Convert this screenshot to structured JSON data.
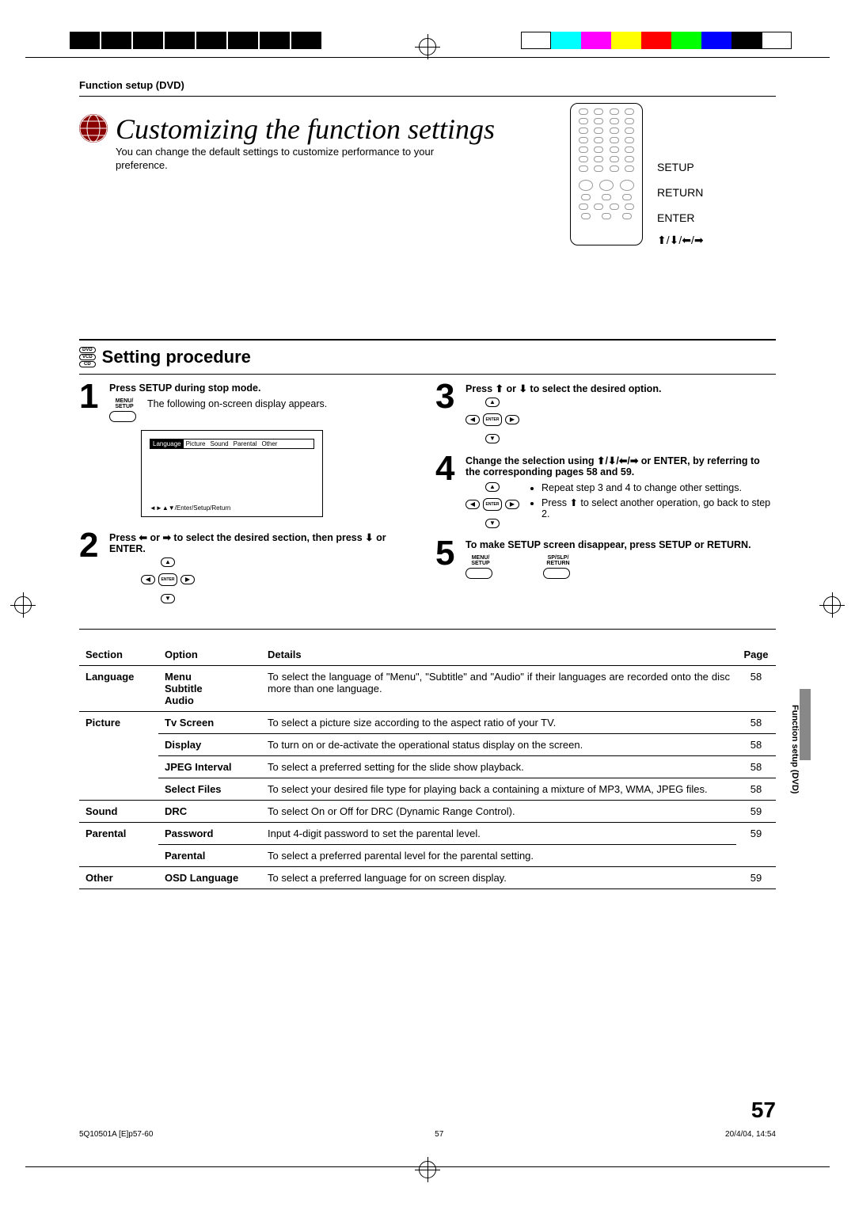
{
  "header": "Function setup (DVD)",
  "title": "Customizing the function settings",
  "intro": "You can change the default settings to customize performance to your preference.",
  "remote_labels": {
    "setup": "SETUP",
    "return": "RETURN",
    "enter": "ENTER"
  },
  "badges": [
    "DVD",
    "VCD",
    "CD"
  ],
  "section_title": "Setting procedure",
  "steps": {
    "s1": {
      "head": "Press SETUP during stop mode.",
      "key": "MENU/\nSETUP",
      "text": "The following on-screen display appears.",
      "osd_tabs": [
        "Language",
        "Picture",
        "Sound",
        "Parental",
        "Other"
      ],
      "osd_foot": "◄►▲▼/Enter/Setup/Return"
    },
    "s2": {
      "head_a": "Press ",
      "head_b": " or ",
      "head_c": " to select the desired section, then press ",
      "head_d": " or ENTER."
    },
    "s3": {
      "head_a": "Press ",
      "head_b": " or ",
      "head_c": " to select the desired option."
    },
    "s4": {
      "head_a": "Change the selection using ",
      "head_b": " or ENTER, by referring to the corresponding pages 58 and 59.",
      "b1": "Repeat step 3 and 4 to change other settings.",
      "b2_a": "Press ",
      "b2_b": " to select another operation, go back to step 2."
    },
    "s5": {
      "head": "To make SETUP screen disappear, press SETUP or RETURN.",
      "key1": "MENU/\nSETUP",
      "key2": "SP/SLP/\nRETURN"
    }
  },
  "table": {
    "h": {
      "section": "Section",
      "option": "Option",
      "details": "Details",
      "page": "Page"
    },
    "rows": [
      {
        "section": "Language",
        "option": "Menu\nSubtitle\nAudio",
        "details": "To select the language of \"Menu\", \"Subtitle\" and \"Audio\" if their languages are recorded onto the disc more than one language.",
        "page": "58",
        "rs": 1
      },
      {
        "section": "Picture",
        "option": "Tv Screen",
        "details": "To select a picture size according to the aspect ratio of your TV.",
        "page": "58",
        "rs": 4
      },
      {
        "section": "",
        "option": "Display",
        "details": "To turn on or de-activate the operational status display on the screen.",
        "page": "58"
      },
      {
        "section": "",
        "option": "JPEG Interval",
        "details": "To select a preferred setting for the slide show playback.",
        "page": "58"
      },
      {
        "section": "",
        "option": "Select Files",
        "details": "To select your desired file type for playing back a containing a mixture of MP3, WMA, JPEG files.",
        "page": "58"
      },
      {
        "section": "Sound",
        "option": "DRC",
        "details": "To select On or Off for DRC (Dynamic Range Control).",
        "page": "59",
        "rs": 1
      },
      {
        "section": "Parental",
        "option": "Password",
        "details": "Input 4-digit password to set the parental level.",
        "page": "59",
        "rs": 2
      },
      {
        "section": "",
        "option": "Parental",
        "details": "To select a preferred parental level for the parental setting.",
        "page": ""
      },
      {
        "section": "Other",
        "option": "OSD Language",
        "details": "To select a preferred language for on screen display.",
        "page": "59",
        "rs": 1
      }
    ]
  },
  "side_tab": "Function setup (DVD)",
  "page_num": "57",
  "footer": {
    "left": "5Q10501A [E]p57-60",
    "mid": "57",
    "right": "20/4/04, 14:54"
  },
  "colors": [
    "#0ff",
    "#f0f",
    "#ff0",
    "#f00",
    "#0f0",
    "#00f",
    "#fff"
  ]
}
